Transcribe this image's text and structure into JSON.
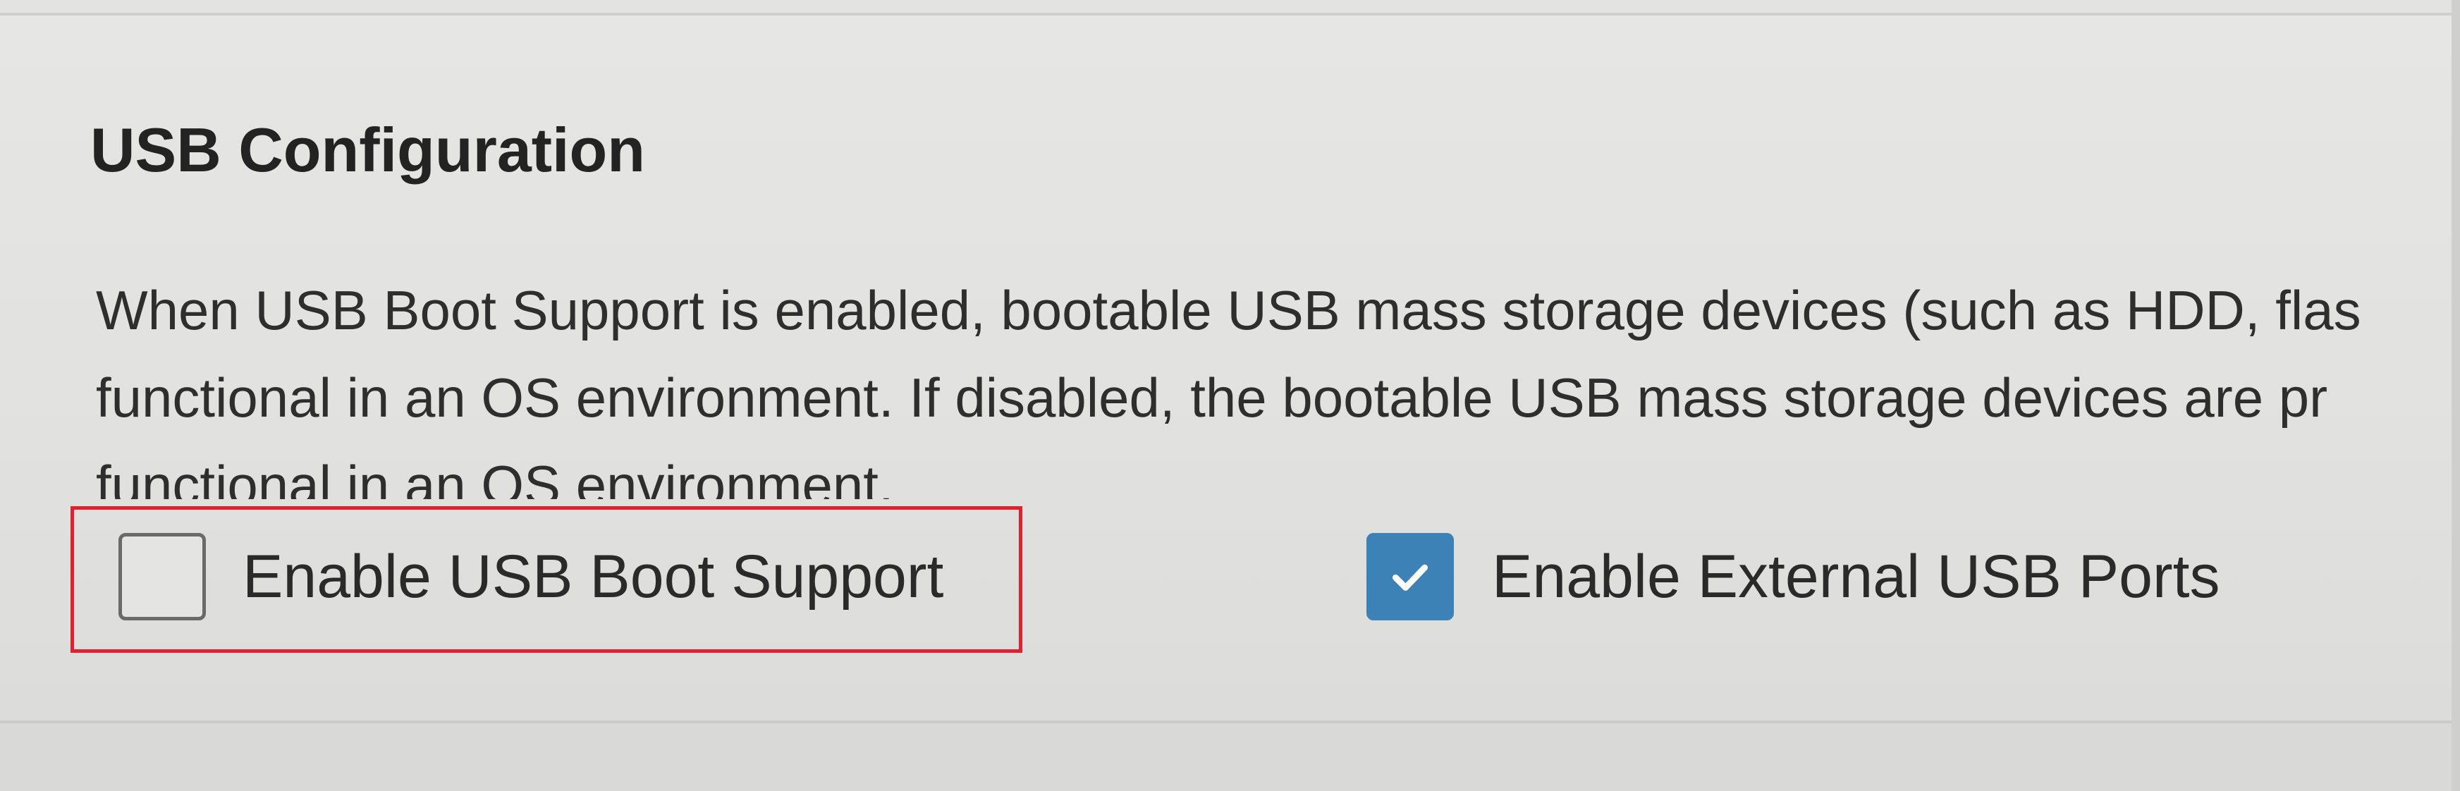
{
  "section": {
    "title": "USB Configuration",
    "description_lines": [
      "When USB Boot Support is enabled, bootable USB mass storage devices (such as HDD, flas",
      "functional in an OS environment. If disabled, the bootable USB mass storage devices are pr",
      "functional in an OS environment."
    ]
  },
  "options": [
    {
      "label": "Enable USB Boot Support",
      "checked": false,
      "highlighted": true
    },
    {
      "label": "Enable External USB Ports",
      "checked": true,
      "highlighted": false
    }
  ],
  "colors": {
    "checkbox_checked": "#3c82b7",
    "highlight_border": "#e2202e",
    "background": "#e3e3e1"
  },
  "icons": {
    "checkmark": "check-icon"
  }
}
